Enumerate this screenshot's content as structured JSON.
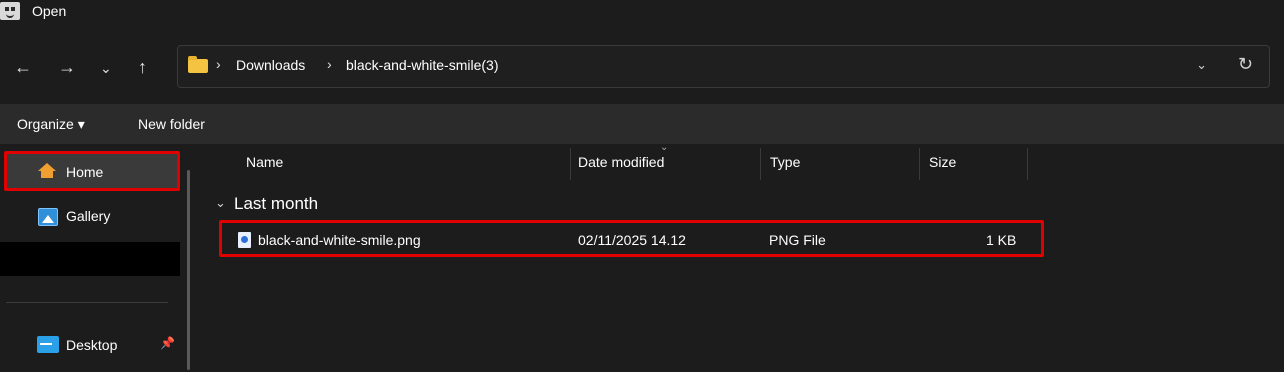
{
  "window": {
    "title": "Open"
  },
  "nav": {
    "back": "←",
    "forward": "→",
    "recent": "⌄",
    "up": "↑",
    "dropdown": "⌄",
    "refresh": "↻"
  },
  "address": {
    "sep": "›",
    "crumbs": [
      "Downloads",
      "black-and-white-smile(3)"
    ]
  },
  "toolbar": {
    "organize": "Organize ▾",
    "new_folder": "New folder"
  },
  "sidebar": {
    "items": [
      {
        "label": "Home",
        "icon": "home-icon"
      },
      {
        "label": "Gallery",
        "icon": "gallery-icon"
      },
      {
        "label": "Desktop",
        "icon": "desktop-icon"
      }
    ],
    "pin": "📌"
  },
  "columns": {
    "name": "Name",
    "date": "Date modified",
    "type": "Type",
    "size": "Size",
    "sort_indicator": "⌄"
  },
  "groups": [
    {
      "label": "Last month",
      "chevron": "⌄",
      "files": [
        {
          "name": "black-and-white-smile.png",
          "date": "02/11/2025 14.12",
          "type": "PNG File",
          "size": "1 KB"
        }
      ]
    }
  ],
  "colors": {
    "highlight": "#e00000",
    "background": "#1c1c1c",
    "command_bar": "#2b2b2b"
  }
}
